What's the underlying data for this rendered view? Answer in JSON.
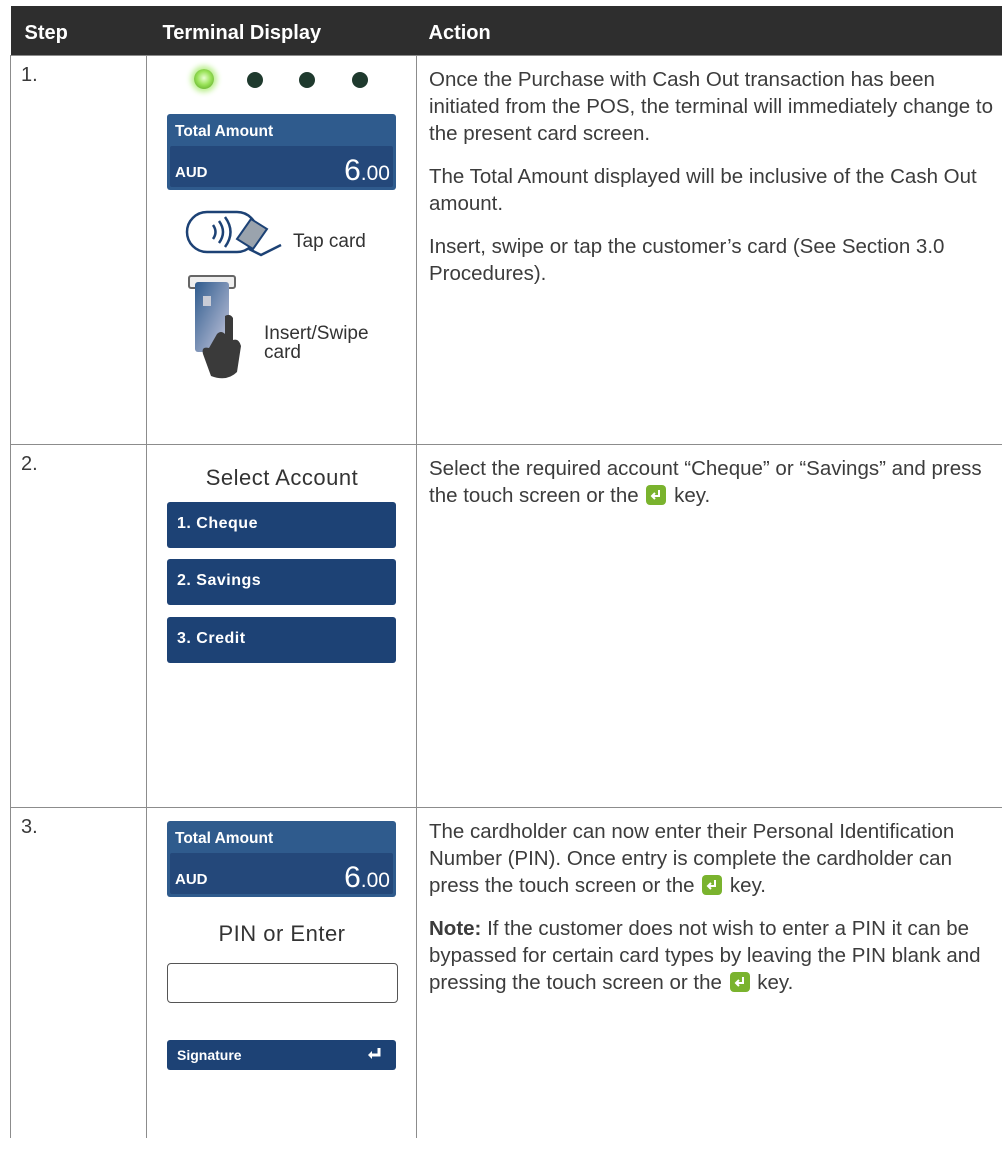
{
  "table": {
    "headers": {
      "step": "Step",
      "display": "Terminal Display",
      "action": "Action"
    },
    "rows": [
      {
        "step": "1.",
        "display": {
          "amount_title": "Total Amount",
          "currency": "AUD",
          "amount_main": "6",
          "amount_cents": ".00",
          "tap_label": "Tap card",
          "insert_label_1": "Insert/Swipe",
          "insert_label_2": "card"
        },
        "action": {
          "p1": "Once the Purchase with Cash Out transaction has been initiated from the POS, the terminal will immediately change to the present card screen.",
          "p2": "The Total Amount displayed will be inclusive of the Cash Out amount.",
          "p3": "Insert, swipe or tap the customer’s card (See Section 3.0 Procedures)."
        }
      },
      {
        "step": "2.",
        "display": {
          "heading": "Select Account",
          "options": [
            "1. Cheque",
            "2. Savings",
            "3. Credit"
          ]
        },
        "action": {
          "p1_before": "Select the required account “Cheque” or “Savings” and press the touch screen or the",
          "p1_after": "key."
        }
      },
      {
        "step": "3.",
        "display": {
          "amount_title": "Total Amount",
          "currency": "AUD",
          "amount_main": "6",
          "amount_cents": ".00",
          "heading": "PIN or Enter",
          "signature_label": "Signature"
        },
        "action": {
          "p1_before": "The cardholder can now enter their Personal Identification Number (PIN). Once entry is complete the cardholder can press the touch screen or the",
          "p1_after": "key.",
          "note_label": "Note:",
          "p2_before": " If the customer does not wish to enter a PIN it can be bypassed for certain card types by leaving the PIN blank and pressing the touch screen or the",
          "p2_after": "key."
        }
      }
    ]
  },
  "colors": {
    "header_bg": "#2e2e2e",
    "panel_blue": "#2f5b8d",
    "button_blue": "#1d4275",
    "enter_key_green": "#7ab32e",
    "led_on": "#9be35a",
    "led_off": "#1f3a2e"
  },
  "icons": [
    "contactless-tap-icon",
    "card-insert-icon",
    "enter-key-icon",
    "status-led-icon"
  ]
}
